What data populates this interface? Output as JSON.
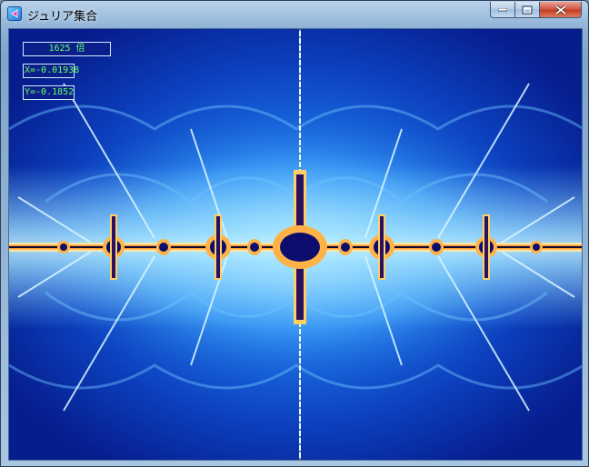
{
  "window": {
    "title": "ジュリア集合"
  },
  "caption_buttons": {
    "minimize_icon": "minimize-icon",
    "maximize_icon": "maximize-icon",
    "close_icon": "close-icon"
  },
  "overlay": {
    "zoom": "1625 倍",
    "x": "X=-0.01938",
    "y": "Y=-0.1852"
  },
  "colors": {
    "text_green": "#66ff66",
    "background_blue": "#0a2da6",
    "close_red": "#c03a22"
  }
}
